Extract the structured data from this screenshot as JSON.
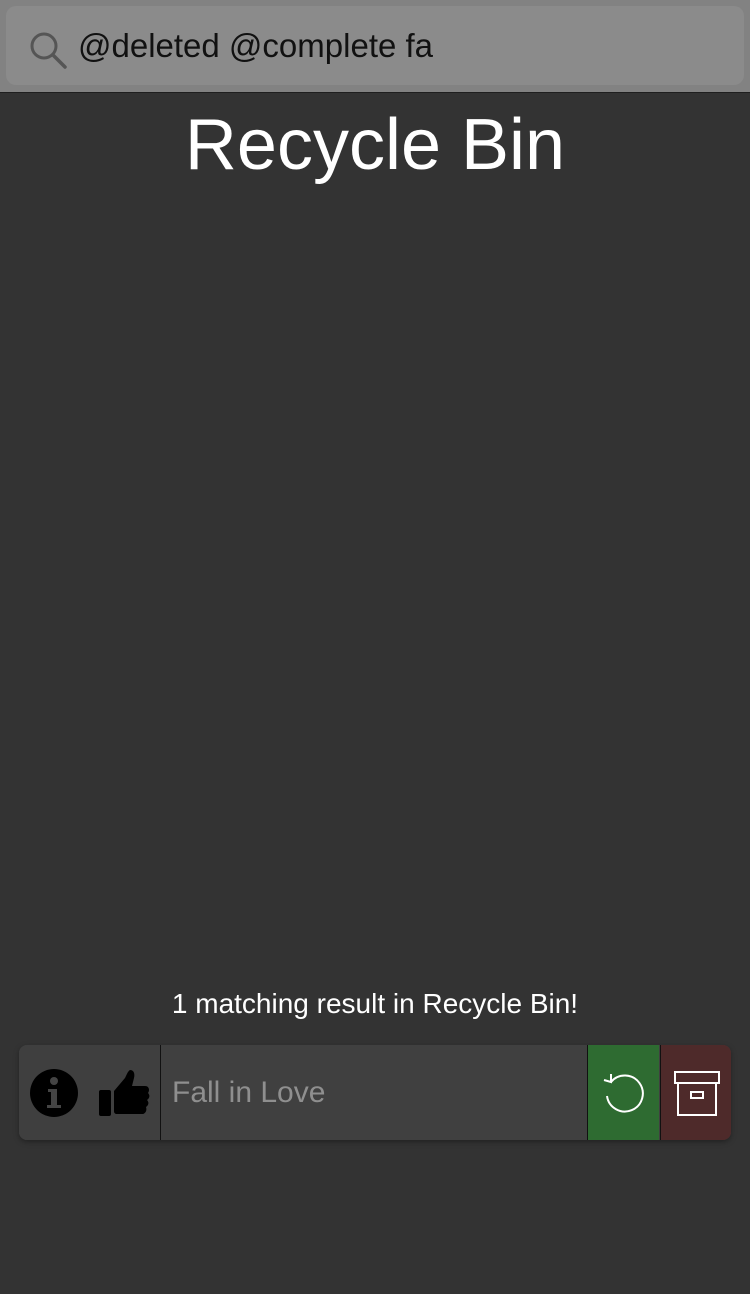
{
  "search": {
    "value": "@deleted @complete fa",
    "icon": "search-icon"
  },
  "page": {
    "title": "Recycle Bin"
  },
  "results": {
    "summary": "1 matching result in Recycle Bin!",
    "items": [
      {
        "title": "Fall in Love",
        "info_icon": "info-icon",
        "like_icon": "thumbs-up-icon",
        "restore_icon": "restore-icon",
        "archive_icon": "archive-box-icon"
      }
    ]
  },
  "colors": {
    "background": "#333333",
    "search_bar": "#828282",
    "restore": "#2e6b31",
    "archive": "#4e2a2a"
  }
}
